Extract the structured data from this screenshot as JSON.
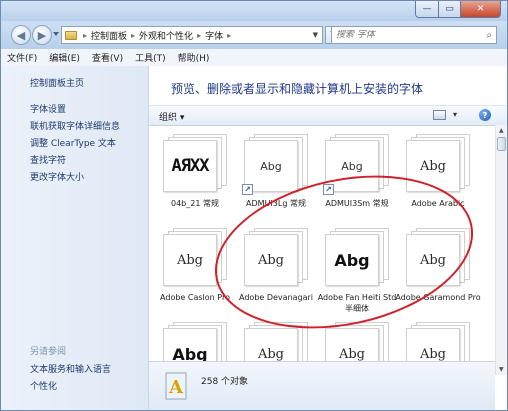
{
  "window": {
    "controls": {
      "minimize": "—",
      "maximize": "▭",
      "close": "✕"
    }
  },
  "address": {
    "crumbs": [
      "控制面板",
      "外观和个性化",
      "字体"
    ],
    "search_placeholder": "搜索 字体"
  },
  "menubar": [
    "文件(F)",
    "编辑(E)",
    "查看(V)",
    "工具(T)",
    "帮助(H)"
  ],
  "sidebar": {
    "home": "控制面板主页",
    "links": [
      "字体设置",
      "联机获取字体详细信息",
      "调整 ClearType 文本",
      "查找字符",
      "更改字体大小"
    ],
    "see_also_title": "另请参阅",
    "see_also": [
      "文本服务和输入语言",
      "个性化"
    ]
  },
  "main": {
    "heading": "预览、删除或者显示和隐藏计算机上安装的字体",
    "organize": "组织 ▾"
  },
  "fonts": [
    {
      "name": "04b_21 常规",
      "preview": "AЯXX",
      "style": "pixel",
      "shortcut": false
    },
    {
      "name": "ADMUI3Lg 常规",
      "preview": "Abg",
      "style": "sans",
      "shortcut": true
    },
    {
      "name": "ADMUI3Sm 常规",
      "preview": "Abg",
      "style": "sans",
      "shortcut": true
    },
    {
      "name": "Adobe Arabic",
      "preview": "Abg",
      "style": "serif",
      "shortcut": false
    },
    {
      "name": "Adobe Caslon Pro",
      "preview": "Abg",
      "style": "serif",
      "shortcut": false
    },
    {
      "name": "Adobe Devanagari",
      "preview": "Abg",
      "style": "serif",
      "shortcut": false
    },
    {
      "name": "Adobe Fan Heiti Std 半细体",
      "preview": "Abg",
      "style": "bold",
      "shortcut": false
    },
    {
      "name": "Adobe Garamond Pro",
      "preview": "Abg",
      "style": "serif",
      "shortcut": false
    },
    {
      "name": "",
      "preview": "Abg",
      "style": "bold",
      "shortcut": false
    },
    {
      "name": "",
      "preview": "Abg",
      "style": "serif",
      "shortcut": false
    },
    {
      "name": "",
      "preview": "Abg",
      "style": "serif",
      "shortcut": false
    },
    {
      "name": "",
      "preview": "Abg",
      "style": "serif",
      "shortcut": false
    }
  ],
  "status": {
    "count": "258 个对象"
  },
  "colors": {
    "accent_link": "#1f3a6b",
    "heading": "#1f3a8a",
    "annotation_ring": "#d0202a"
  }
}
